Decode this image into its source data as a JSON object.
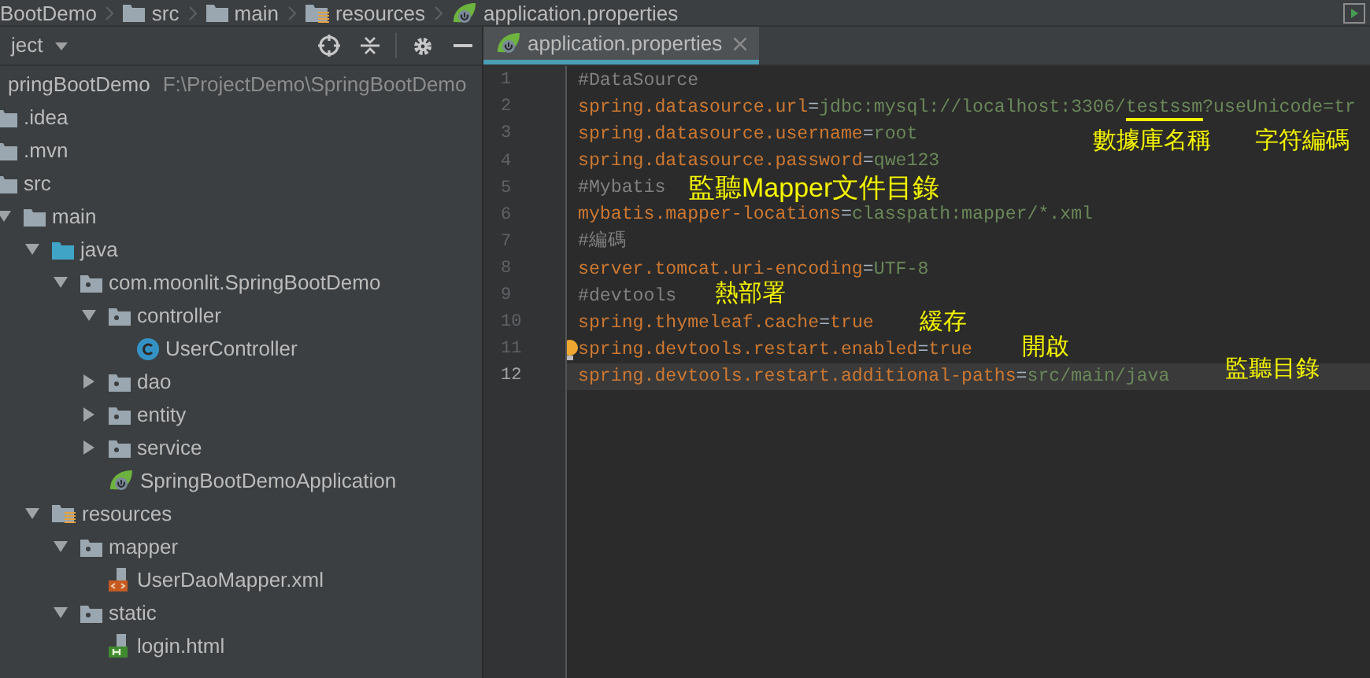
{
  "breadcrumbs": [
    {
      "label": "BootDemo"
    },
    {
      "label": "src",
      "kind": "folder"
    },
    {
      "label": "main",
      "kind": "folder"
    },
    {
      "label": "resources",
      "kind": "resources"
    },
    {
      "label": "application.properties",
      "kind": "spring"
    }
  ],
  "project_panel": {
    "title": "ject",
    "tree": [
      {
        "label": "pringBootDemo",
        "path": "F:\\ProjectDemo\\SpringBootDemo",
        "children": [
          {
            "label": ".idea",
            "kind": "folder"
          },
          {
            "label": ".mvn",
            "kind": "folder"
          },
          {
            "label": "src",
            "kind": "folder",
            "children": [
              {
                "label": "main",
                "kind": "folder",
                "expanded": true,
                "children": [
                  {
                    "label": "java",
                    "kind": "source",
                    "expanded": true,
                    "children": [
                      {
                        "label": "com.moonlit.SpringBootDemo",
                        "kind": "package",
                        "expanded": true,
                        "children": [
                          {
                            "label": "controller",
                            "kind": "package",
                            "expanded": true,
                            "children": [
                              {
                                "label": "UserController",
                                "kind": "class"
                              }
                            ]
                          },
                          {
                            "label": "dao",
                            "kind": "package",
                            "expanded": false
                          },
                          {
                            "label": "entity",
                            "kind": "package",
                            "expanded": false
                          },
                          {
                            "label": "service",
                            "kind": "package",
                            "expanded": false
                          },
                          {
                            "label": "SpringBootDemoApplication",
                            "kind": "spring"
                          }
                        ]
                      }
                    ]
                  },
                  {
                    "label": "resources",
                    "kind": "resources",
                    "expanded": true,
                    "children": [
                      {
                        "label": "mapper",
                        "kind": "package",
                        "expanded": true,
                        "children": [
                          {
                            "label": "UserDaoMapper.xml",
                            "kind": "xml"
                          }
                        ]
                      },
                      {
                        "label": "static",
                        "kind": "package",
                        "expanded": true,
                        "children": [
                          {
                            "label": "login.html",
                            "kind": "html"
                          }
                        ]
                      }
                    ]
                  }
                ]
              }
            ]
          }
        ]
      }
    ]
  },
  "editor": {
    "tabs": [
      {
        "label": "application.properties",
        "selected": true
      }
    ],
    "lines": [
      {
        "number": "1",
        "current": false,
        "tokens": [
          {
            "text": "#DataSource",
            "kind": "comment"
          }
        ]
      },
      {
        "number": "2",
        "current": false,
        "tokens": [
          {
            "text": "spring.datasource.url",
            "kind": "key"
          },
          {
            "text": "=",
            "kind": "sep"
          },
          {
            "text": "jdbc:mysql://localhost:3306/",
            "kind": "value"
          },
          {
            "text": "testssm",
            "kind": "value",
            "underlined": true
          },
          {
            "text": "?useUnicode=tr",
            "kind": "value"
          }
        ]
      },
      {
        "number": "3",
        "current": false,
        "tokens": [
          {
            "text": "spring.datasource.username",
            "kind": "key"
          },
          {
            "text": "=",
            "kind": "sep"
          },
          {
            "text": "root",
            "kind": "value"
          }
        ]
      },
      {
        "number": "4",
        "current": false,
        "tokens": [
          {
            "text": "spring.datasource.password",
            "kind": "key"
          },
          {
            "text": "=",
            "kind": "sep"
          },
          {
            "text": "qwe123",
            "kind": "value"
          }
        ]
      },
      {
        "number": "5",
        "current": false,
        "tokens": [
          {
            "text": "#Mybatis",
            "kind": "comment"
          }
        ]
      },
      {
        "number": "6",
        "current": false,
        "tokens": [
          {
            "text": "mybatis.mapper-locations",
            "kind": "key"
          },
          {
            "text": "=",
            "kind": "sep"
          },
          {
            "text": "classpath:mapper/*.xml",
            "kind": "value"
          }
        ]
      },
      {
        "number": "7",
        "current": false,
        "tokens": [
          {
            "text": "#編碼",
            "kind": "comment"
          }
        ]
      },
      {
        "number": "8",
        "current": false,
        "tokens": [
          {
            "text": "server.tomcat.uri-encoding",
            "kind": "key"
          },
          {
            "text": "=",
            "kind": "sep"
          },
          {
            "text": "UTF-8",
            "kind": "value"
          }
        ]
      },
      {
        "number": "9",
        "current": false,
        "tokens": [
          {
            "text": "#devtools",
            "kind": "comment"
          }
        ]
      },
      {
        "number": "10",
        "current": false,
        "tokens": [
          {
            "text": "spring.thymeleaf.cache",
            "kind": "key"
          },
          {
            "text": "=",
            "kind": "sep"
          },
          {
            "text": "true",
            "kind": "keyword"
          }
        ]
      },
      {
        "number": "11",
        "current": false,
        "hint": true,
        "tokens": [
          {
            "text": "spring.devtools.restart.enabled",
            "kind": "key"
          },
          {
            "text": "=",
            "kind": "sep"
          },
          {
            "text": "true",
            "kind": "keyword"
          }
        ]
      },
      {
        "number": "12",
        "current": true,
        "tokens": [
          {
            "text": "spring.devtools.restart.additional-paths",
            "kind": "key"
          },
          {
            "text": "=",
            "kind": "sep"
          },
          {
            "text": "src/main/java",
            "kind": "value"
          }
        ]
      }
    ]
  },
  "annotations": [
    {
      "text": "數據庫名稱"
    },
    {
      "text": "字符編碼"
    },
    {
      "text": "監聽Mapper文件目錄"
    },
    {
      "text": "熱部署"
    },
    {
      "text": "緩存"
    },
    {
      "text": "開啟"
    },
    {
      "text": "監聽目錄"
    }
  ]
}
